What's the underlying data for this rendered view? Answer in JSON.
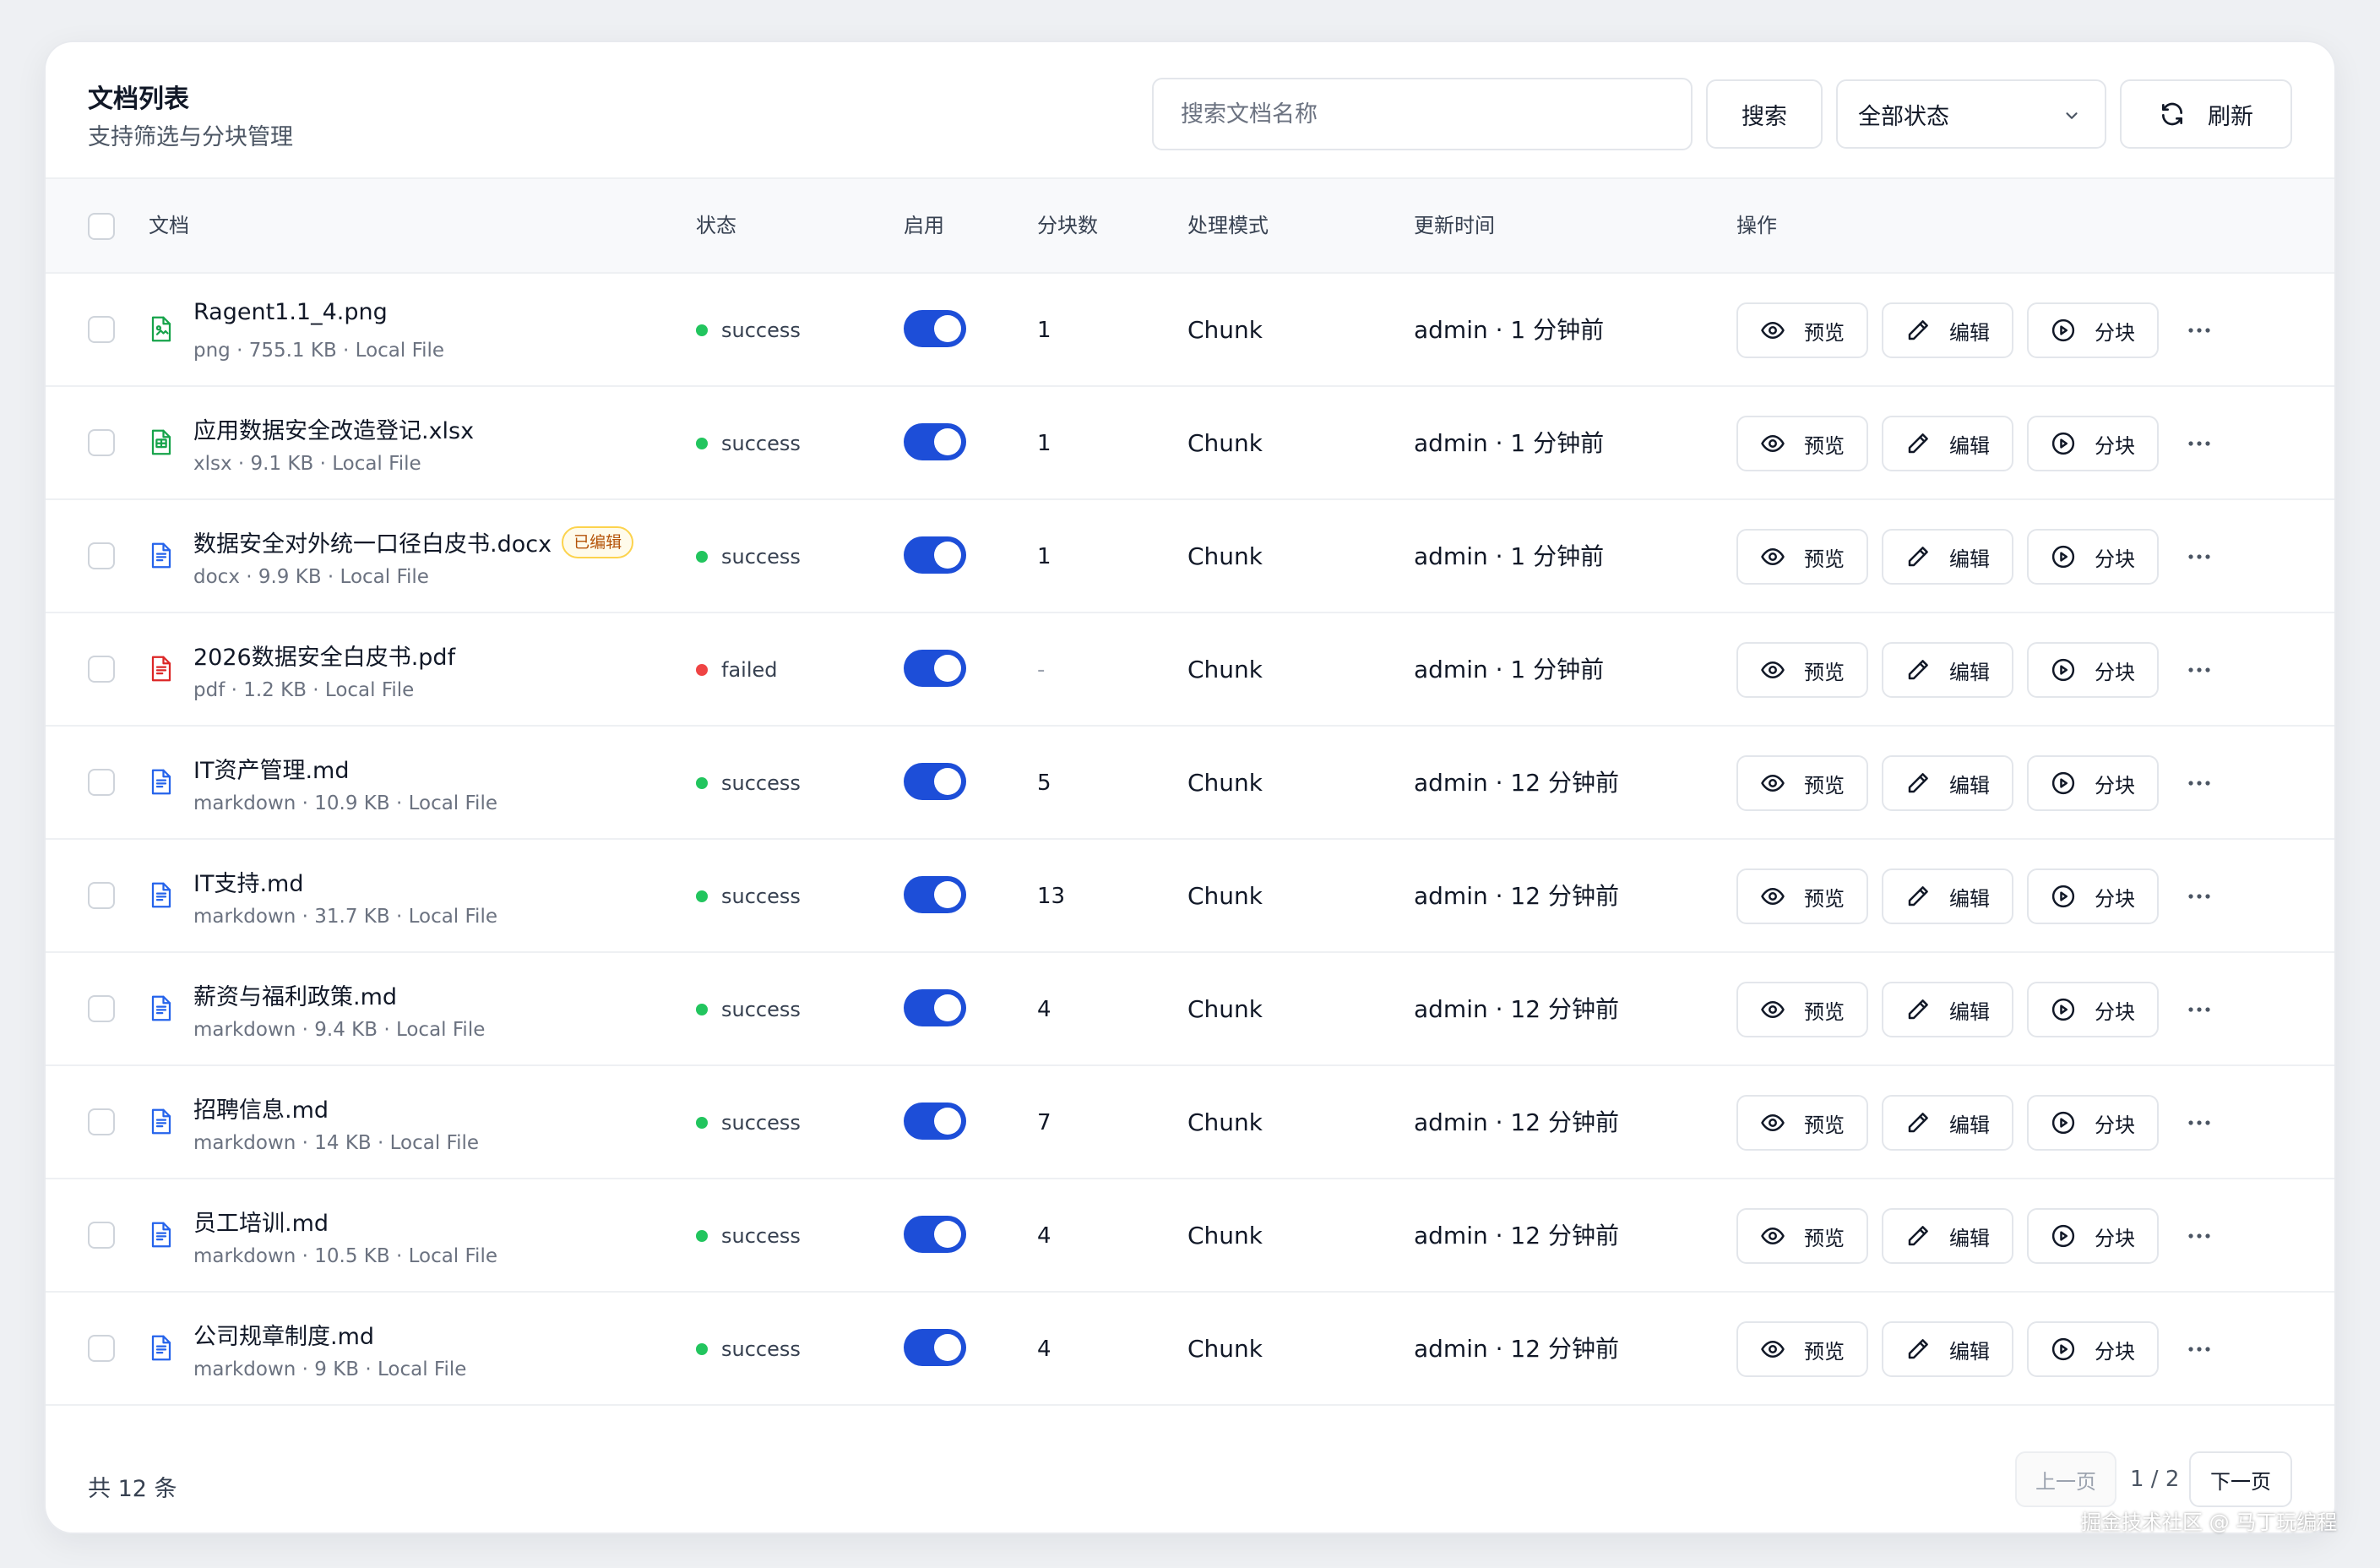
{
  "header": {
    "title": "文档列表",
    "subtitle": "支持筛选与分块管理",
    "search_placeholder": "搜索文档名称",
    "search_label": "搜索",
    "status_filter": "全部状态",
    "refresh_label": "刷新"
  },
  "columns": [
    "文档",
    "状态",
    "启用",
    "分块数",
    "处理模式",
    "更新时间",
    "操作"
  ],
  "actions": {
    "preview": "预览",
    "edit": "编辑",
    "chunk": "分块"
  },
  "colors": {
    "accent": "#1d4ed8",
    "success": "#22c55e",
    "failed": "#ef4444",
    "image_icon": "#16a34a",
    "sheet_icon": "#16a34a",
    "pdf_icon": "#dc2626",
    "doc_icon": "#2563eb"
  },
  "rows": [
    {
      "name": "Ragent1.1_4.png",
      "meta": "png · 755.1 KB · Local File",
      "icon": "image-file-icon",
      "badge": "",
      "status": "success",
      "enabled": true,
      "chunks": "1",
      "mode": "Chunk",
      "updated": "admin · 1 分钟前"
    },
    {
      "name": "应用数据安全改造登记.xlsx",
      "meta": "xlsx · 9.1 KB · Local File",
      "icon": "spreadsheet-file-icon",
      "badge": "",
      "status": "success",
      "enabled": true,
      "chunks": "1",
      "mode": "Chunk",
      "updated": "admin · 1 分钟前"
    },
    {
      "name": "数据安全对外统一口径白皮书.docx",
      "meta": "docx · 9.9 KB · Local File",
      "icon": "document-file-icon",
      "badge": "已编辑",
      "status": "success",
      "enabled": true,
      "chunks": "1",
      "mode": "Chunk",
      "updated": "admin · 1 分钟前"
    },
    {
      "name": "2026数据安全白皮书.pdf",
      "meta": "pdf · 1.2 KB · Local File",
      "icon": "pdf-file-icon",
      "badge": "",
      "status": "failed",
      "enabled": true,
      "chunks": "-",
      "mode": "Chunk",
      "updated": "admin · 1 分钟前"
    },
    {
      "name": "IT资产管理.md",
      "meta": "markdown · 10.9 KB · Local File",
      "icon": "document-file-icon",
      "badge": "",
      "status": "success",
      "enabled": true,
      "chunks": "5",
      "mode": "Chunk",
      "updated": "admin · 12 分钟前"
    },
    {
      "name": "IT支持.md",
      "meta": "markdown · 31.7 KB · Local File",
      "icon": "document-file-icon",
      "badge": "",
      "status": "success",
      "enabled": true,
      "chunks": "13",
      "mode": "Chunk",
      "updated": "admin · 12 分钟前"
    },
    {
      "name": "薪资与福利政策.md",
      "meta": "markdown · 9.4 KB · Local File",
      "icon": "document-file-icon",
      "badge": "",
      "status": "success",
      "enabled": true,
      "chunks": "4",
      "mode": "Chunk",
      "updated": "admin · 12 分钟前"
    },
    {
      "name": "招聘信息.md",
      "meta": "markdown · 14 KB · Local File",
      "icon": "document-file-icon",
      "badge": "",
      "status": "success",
      "enabled": true,
      "chunks": "7",
      "mode": "Chunk",
      "updated": "admin · 12 分钟前"
    },
    {
      "name": "员工培训.md",
      "meta": "markdown · 10.5 KB · Local File",
      "icon": "document-file-icon",
      "badge": "",
      "status": "success",
      "enabled": true,
      "chunks": "4",
      "mode": "Chunk",
      "updated": "admin · 12 分钟前"
    },
    {
      "name": "公司规章制度.md",
      "meta": "markdown · 9 KB · Local File",
      "icon": "document-file-icon",
      "badge": "",
      "status": "success",
      "enabled": true,
      "chunks": "4",
      "mode": "Chunk",
      "updated": "admin · 12 分钟前"
    }
  ],
  "footer": {
    "total": "共 12 条",
    "prev_label": "上一页",
    "page_indicator": "1 / 2",
    "next_label": "下一页"
  },
  "watermark": "掘金技术社区 @ 马丁玩编程"
}
